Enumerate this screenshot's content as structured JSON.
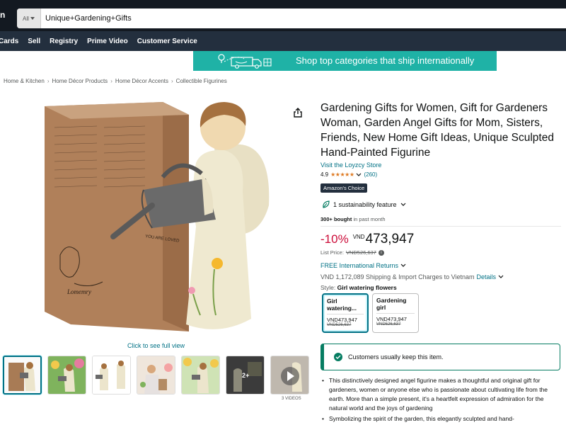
{
  "header": {
    "logo_fragment": "n",
    "search": {
      "department": "All",
      "query": "Unique+Gardening+Gifts"
    }
  },
  "nav": {
    "items": [
      "Cards",
      "Sell",
      "Registry",
      "Prime Video",
      "Customer Service"
    ]
  },
  "banner": {
    "text": "Shop top categories that ship internationally",
    "icon": "delivery-truck-icon"
  },
  "breadcrumb": [
    "Home & Kitchen",
    "Home Décor Products",
    "Home Décor Accents",
    "Collectible Figurines"
  ],
  "gallery": {
    "full_view_label": "Click to see full view",
    "thumbnail_count": 7,
    "more_label": "2+",
    "video_caption": "3 VIDEOS"
  },
  "product": {
    "title": "Gardening Gifts for Women, Gift for Gardeners Woman, Garden Angel Gifts for Mom, Sisters, Friends, New Home Gift Ideas, Unique Sculpted Hand-Painted Figurine",
    "store_link": "Visit the Loyzcy Store",
    "rating": "4.9",
    "stars_value": 4.9,
    "review_count": "(260)",
    "badge": "Amazon's Choice",
    "sustainability": "1 sustainability feature",
    "bought_bold": "300+ bought",
    "bought_rest": " in past month",
    "discount": "-10%",
    "currency": "VND",
    "price": "473,947",
    "list_price_label": "List Price:",
    "list_price": "VND526,637",
    "returns": "FREE International Returns",
    "shipping": "VND 1,172,089 Shipping & Import Charges to Vietnam",
    "shipping_details": "Details",
    "style_label": "Style:",
    "style_value": "Girl watering flowers",
    "styles": [
      {
        "name": "Girl watering...",
        "price": "VND473,947",
        "list": "VND526,637"
      },
      {
        "name": "Gardening girl",
        "price": "VND473,947",
        "list": "VND526,637"
      }
    ],
    "keep_message": "Customers usually keep this item.",
    "bullets": [
      "This distinctively designed angel figurine makes a thoughtful and original gift for gardeners, women or anyone else who is passionate about cultivating life from the earth. More than a simple present, it's a heartfelt expression of admiration for the natural world and the joys of gardening",
      "Symbolizing the spirit of the garden, this elegantly sculpted and hand-"
    ]
  },
  "box_text": {
    "label": "YOU ARE LOVED",
    "brand": "Lomemry"
  },
  "colors": {
    "header_bg": "#131921",
    "nav_bg": "#232f3e",
    "banner_bg": "#1fb2a6",
    "link": "#007185",
    "discount": "#cc0c39",
    "star": "#de7921",
    "success": "#067d62"
  }
}
